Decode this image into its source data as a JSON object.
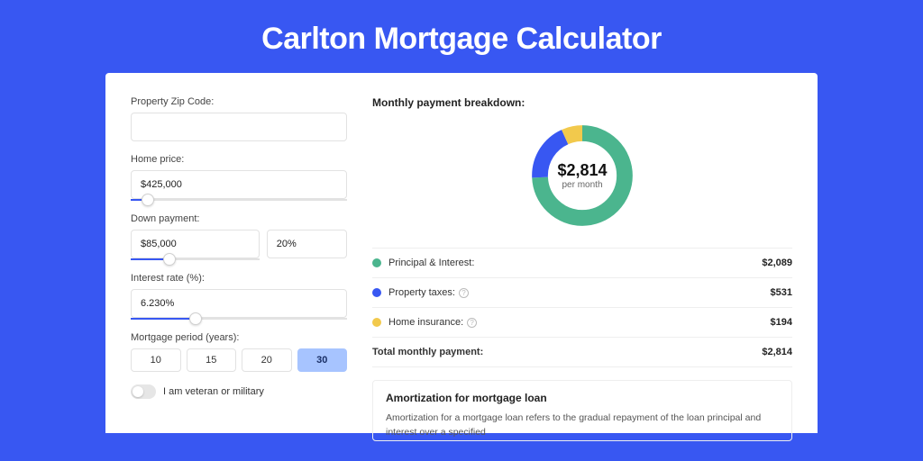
{
  "title": "Carlton Mortgage Calculator",
  "form": {
    "zip_label": "Property Zip Code:",
    "zip_value": "",
    "price_label": "Home price:",
    "price_value": "$425,000",
    "price_slider_pct": 8,
    "down_label": "Down payment:",
    "down_value": "$85,000",
    "down_pct_value": "20%",
    "down_slider_pct": 20,
    "rate_label": "Interest rate (%):",
    "rate_value": "6.230%",
    "rate_slider_pct": 30,
    "period_label": "Mortgage period (years):",
    "periods": [
      "10",
      "15",
      "20",
      "30"
    ],
    "period_selected": "30",
    "veteran_label": "I am veteran or military"
  },
  "breakdown": {
    "title": "Monthly payment breakdown:",
    "center_amount": "$2,814",
    "center_sub": "per month",
    "items": [
      {
        "label": "Principal & Interest:",
        "value": "$2,089",
        "color": "#4bb58e",
        "info": false
      },
      {
        "label": "Property taxes:",
        "value": "$531",
        "color": "#3857f2",
        "info": true
      },
      {
        "label": "Home insurance:",
        "value": "$194",
        "color": "#f2c94c",
        "info": true
      }
    ],
    "total_label": "Total monthly payment:",
    "total_value": "$2,814"
  },
  "chart_data": {
    "type": "pie",
    "title": "Monthly payment breakdown",
    "series": [
      {
        "name": "Principal & Interest",
        "value": 2089,
        "color": "#4bb58e"
      },
      {
        "name": "Property taxes",
        "value": 531,
        "color": "#3857f2"
      },
      {
        "name": "Home insurance",
        "value": 194,
        "color": "#f2c94c"
      }
    ],
    "total": 2814,
    "unit": "USD per month"
  },
  "amort": {
    "title": "Amortization for mortgage loan",
    "text": "Amortization for a mortgage loan refers to the gradual repayment of the loan principal and interest over a specified"
  }
}
